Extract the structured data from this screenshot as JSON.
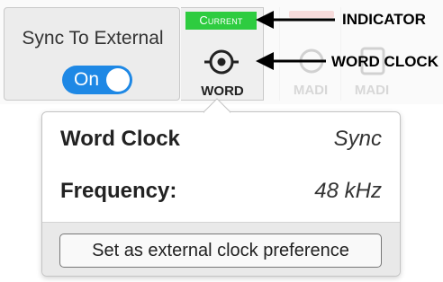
{
  "sync": {
    "label": "Sync To External",
    "toggle_label": "On"
  },
  "word_tile": {
    "badge": "Current",
    "label": "WORD",
    "icon": "target-icon"
  },
  "madi_tiles": [
    {
      "label": "MADI"
    },
    {
      "label": "MADI"
    }
  ],
  "popover": {
    "rows": [
      {
        "key": "Word Clock",
        "value": "Sync"
      },
      {
        "key": "Frequency:",
        "value": "48 kHz"
      }
    ],
    "button_label": "Set as external clock preference"
  },
  "annotations": {
    "indicator": "INDICATOR",
    "word_clock": "WORD CLOCK"
  },
  "colors": {
    "toggle_on": "#1e88e5",
    "badge_current": "#2ecc40"
  }
}
